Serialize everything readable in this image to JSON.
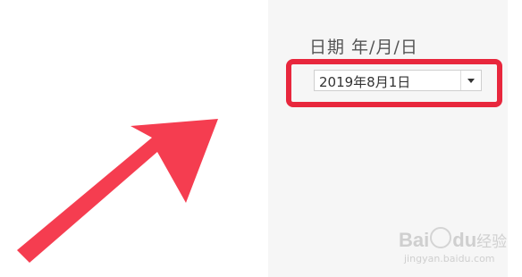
{
  "field": {
    "label": "日期 年/月/日",
    "value": "2019年8月1日"
  },
  "annotation": {
    "highlight_color": "#e8273d",
    "arrow_color": "#f53d50",
    "arrow_direction": "up-right"
  },
  "watermark": {
    "brand_latin_1": "Bai",
    "brand_latin_2": "du",
    "brand_cn": "经验",
    "url": "jingyan.baidu.com"
  },
  "icons": {
    "dropdown": "chevron-down-icon",
    "watermark_logo": "paw-icon"
  }
}
